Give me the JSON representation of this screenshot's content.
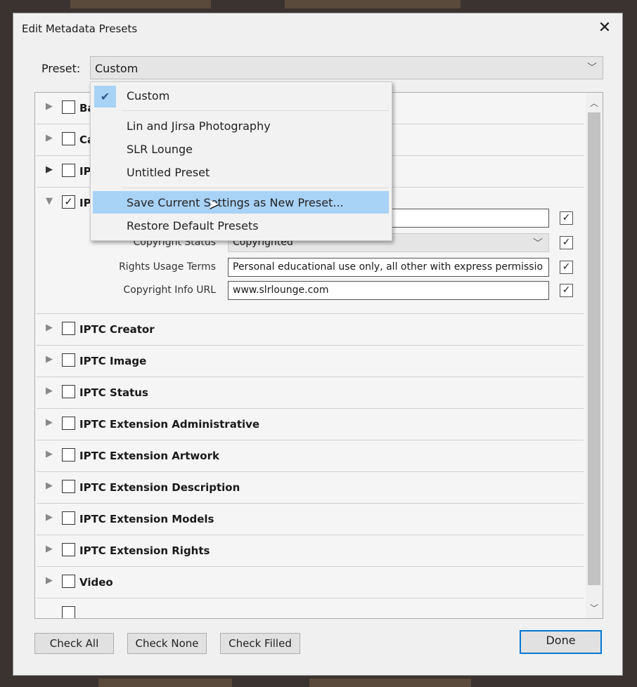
{
  "dialog": {
    "title": "Edit Metadata Presets",
    "close_icon": "close-icon"
  },
  "preset": {
    "label": "Preset:",
    "value": "Custom"
  },
  "menu": {
    "items": [
      {
        "label": "Custom",
        "checked": true
      },
      {
        "label": "Lin and Jirsa Photography"
      },
      {
        "label": "SLR Lounge"
      },
      {
        "label": "Untitled Preset"
      },
      {
        "label": "Save Current Settings as New Preset...",
        "highlighted": true
      },
      {
        "label": "Restore Default Presets"
      }
    ]
  },
  "sections": [
    {
      "label": "Basic Info",
      "checked": false
    },
    {
      "label": "Camera Info",
      "checked": false
    },
    {
      "label": "IPTC Content",
      "checked": false
    },
    {
      "label": "IPTC Copyright",
      "checked": true,
      "expanded": true
    },
    {
      "label": "IPTC Creator",
      "checked": false
    },
    {
      "label": "IPTC Image",
      "checked": false
    },
    {
      "label": "IPTC Status",
      "checked": false
    },
    {
      "label": "IPTC Extension Administrative",
      "checked": false
    },
    {
      "label": "IPTC Extension Artwork",
      "checked": false
    },
    {
      "label": "IPTC Extension Description",
      "checked": false
    },
    {
      "label": "IPTC Extension Models",
      "checked": false
    },
    {
      "label": "IPTC Extension Rights",
      "checked": false
    },
    {
      "label": "Video",
      "checked": false
    }
  ],
  "copyright_fields": [
    {
      "label": "",
      "value": ""
    },
    {
      "label": "Copyright Status",
      "value": "Copyrighted"
    },
    {
      "label": "Rights Usage Terms",
      "value": "Personal educational use only, all other with express permissio"
    },
    {
      "label": "Copyright Info URL",
      "value": "www.slrlounge.com"
    }
  ],
  "buttons": {
    "check_all": "Check All",
    "check_none": "Check None",
    "check_filled": "Check Filled",
    "done": "Done"
  },
  "colors": {
    "highlight": "#a8d2f6",
    "accent": "#0078d7"
  }
}
